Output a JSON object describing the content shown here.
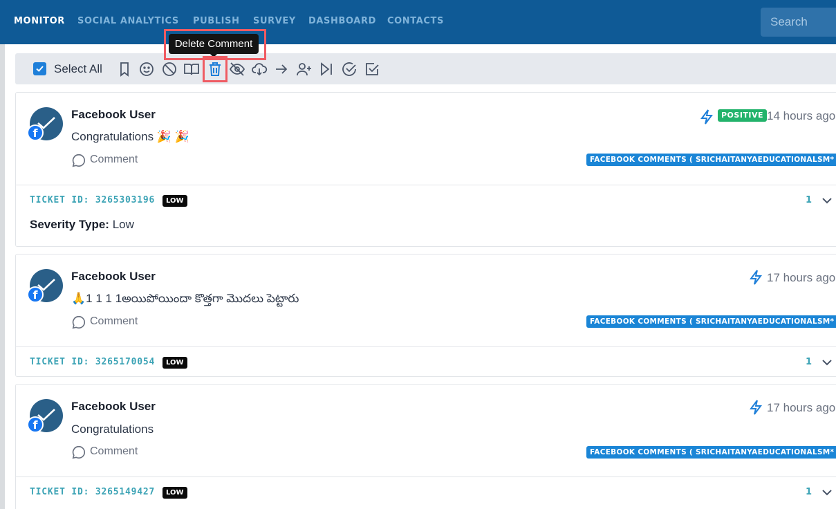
{
  "nav": {
    "items": [
      "MONITOR",
      "SOCIAL ANALYTICS",
      "PUBLISH",
      "SURVEY",
      "DASHBOARD",
      "CONTACTS"
    ],
    "search_placeholder": "Search"
  },
  "toolbar": {
    "select_all_label": "Select All",
    "icons": [
      "bookmark-icon",
      "smiley-icon",
      "block-icon",
      "book-open-icon",
      "trash-icon",
      "eye-off-icon",
      "cloud-download-icon",
      "arrow-right-icon",
      "user-plus-icon",
      "skip-forward-icon",
      "check-circle-icon",
      "check-square-icon"
    ],
    "tooltip": "Delete Comment"
  },
  "colors": {
    "nav_bg": "#0f5a96",
    "accent": "#1e7fd9",
    "positive": "#22b36b",
    "teal": "#3ba3b5",
    "highlight": "#ef5b62"
  },
  "posts": [
    {
      "user": "Facebook User",
      "message": "Congratulations 🎉 🎉",
      "comment_label": "Comment",
      "sentiment": "POSITIVE",
      "time": "14 hours ago",
      "source": "FACEBOOK COMMENTS ( SRICHAITANYAEDUCATIONALSM* )",
      "ticket_id": "TICKET ID: 3265303196",
      "priority": "LOW",
      "count": "1",
      "severity_label": "Severity Type:",
      "severity_value": "Low"
    },
    {
      "user": "Facebook User",
      "message": "🙏1 1 1 1అయిపోయిందా కొత్తగా మొదలు పెట్టారు",
      "comment_label": "Comment",
      "time": "17 hours ago",
      "source": "FACEBOOK COMMENTS ( SRICHAITANYAEDUCATIONALSM* )",
      "ticket_id": "TICKET ID: 3265170054",
      "priority": "LOW",
      "count": "1"
    },
    {
      "user": "Facebook User",
      "message": "Congratulations",
      "comment_label": "Comment",
      "time": "17 hours ago",
      "source": "FACEBOOK COMMENTS ( SRICHAITANYAEDUCATIONALSM* )",
      "ticket_id": "TICKET ID: 3265149427",
      "priority": "LOW",
      "count": "1"
    }
  ]
}
